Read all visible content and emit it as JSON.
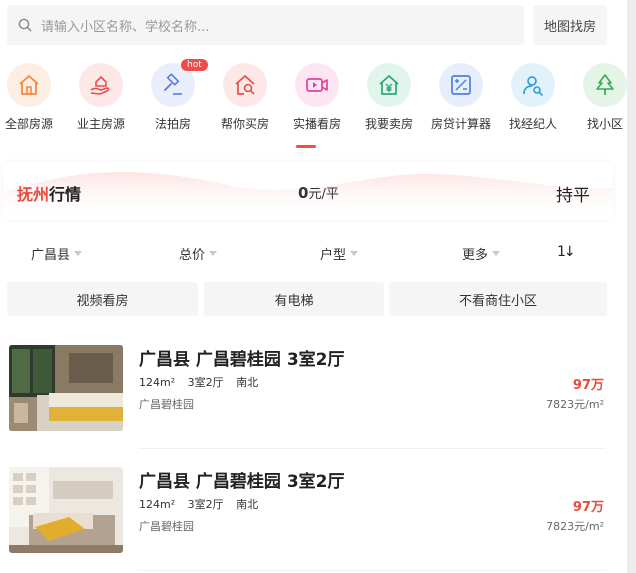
{
  "search": {
    "placeholder": "请输入小区名称、学校名称...",
    "map_button": "地图找房"
  },
  "categories": [
    {
      "label": "全部房源",
      "icon": "house-icon",
      "color": "#f58a3c",
      "bg": "#fdeee3"
    },
    {
      "label": "业主房源",
      "icon": "hand-house-icon",
      "color": "#e8504a",
      "bg": "#fde8e8"
    },
    {
      "label": "法拍房",
      "icon": "gavel-icon",
      "color": "#5a7be0",
      "bg": "#e8eefc",
      "badge": "hot"
    },
    {
      "label": "帮你买房",
      "icon": "house-search-icon",
      "color": "#e8504a",
      "bg": "#fde8e8"
    },
    {
      "label": "实播看房",
      "icon": "video-icon",
      "color": "#e0459a",
      "bg": "#fce6f1"
    },
    {
      "label": "我要卖房",
      "icon": "yuan-house-icon",
      "color": "#2aa876",
      "bg": "#e2f5ec"
    },
    {
      "label": "房贷计算器",
      "icon": "calculator-icon",
      "color": "#4e7fe0",
      "bg": "#e6eefc"
    },
    {
      "label": "找经纪人",
      "icon": "agent-icon",
      "color": "#2e9fd6",
      "bg": "#e2f2fb"
    },
    {
      "label": "找小区",
      "icon": "tree-icon",
      "color": "#3aa85a",
      "bg": "#e4f5e8"
    }
  ],
  "market": {
    "city": "抚州",
    "title": "行情",
    "price_value": "0",
    "price_unit": "元/平",
    "trend": "持平"
  },
  "filters": {
    "area": "广昌县",
    "price": "总价",
    "layout": "户型",
    "more": "更多",
    "sort": "1↓"
  },
  "tags": [
    "视频看房",
    "有电梯",
    "不看商住小区"
  ],
  "listings": [
    {
      "title": "广昌县 广昌碧桂园 3室2厅",
      "area": "124m²",
      "rooms": "3室2厅",
      "orientation": "南北",
      "community": "广昌碧桂园",
      "total": "97万",
      "unit_price": "7823元/m²"
    },
    {
      "title": "广昌县 广昌碧桂园 3室2厅",
      "area": "124m²",
      "rooms": "3室2厅",
      "orientation": "南北",
      "community": "广昌碧桂园",
      "total": "97万",
      "unit_price": "7823元/m²"
    }
  ],
  "colors": {
    "accent": "#e84b3c",
    "tab_underline": "#f04e3e"
  }
}
